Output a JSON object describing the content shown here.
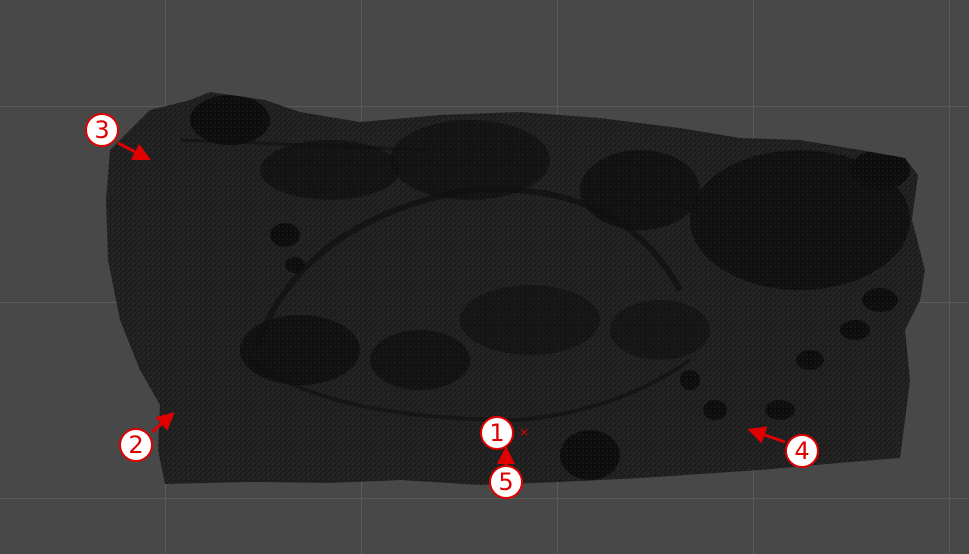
{
  "scene": {
    "background_color": "#484848",
    "grid_color": "#5a5a5a",
    "mesh_color": "#1f1f1f",
    "wire_color": "#0d0d0d",
    "marker_color": "#e00000"
  },
  "markers": [
    {
      "label": "1"
    },
    {
      "label": "2"
    },
    {
      "label": "3"
    },
    {
      "label": "4"
    },
    {
      "label": "5"
    }
  ],
  "origin_symbol": "×"
}
